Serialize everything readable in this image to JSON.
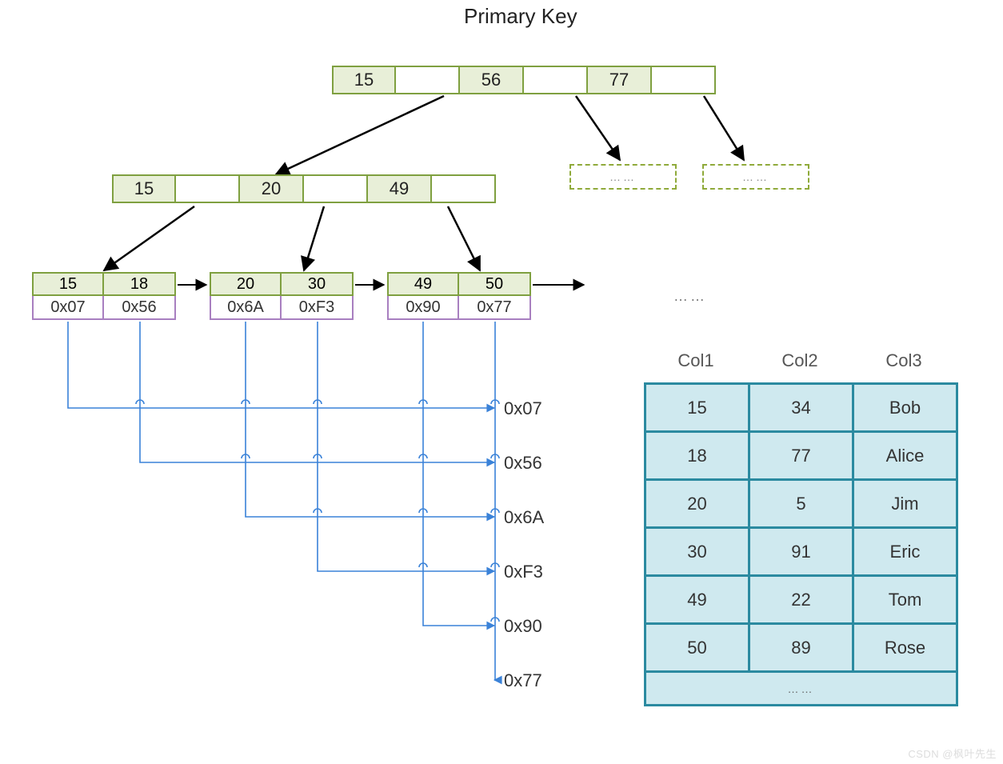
{
  "title": "Primary Key",
  "root": {
    "keys": [
      "15",
      "56",
      "77"
    ]
  },
  "level2": {
    "keys": [
      "15",
      "20",
      "49"
    ]
  },
  "placeholder": "……",
  "leaves": [
    {
      "keys": [
        "15",
        "18"
      ],
      "ptrs": [
        "0x07",
        "0x56"
      ]
    },
    {
      "keys": [
        "20",
        "30"
      ],
      "ptrs": [
        "0x6A",
        "0xF3"
      ]
    },
    {
      "keys": [
        "49",
        "50"
      ],
      "ptrs": [
        "0x90",
        "0x77"
      ]
    }
  ],
  "leaf_trail": "……",
  "addresses": [
    "0x07",
    "0x56",
    "0x6A",
    "0xF3",
    "0x90",
    "0x77"
  ],
  "table": {
    "headers": [
      "Col1",
      "Col2",
      "Col3"
    ],
    "rows": [
      [
        "15",
        "34",
        "Bob"
      ],
      [
        "18",
        "77",
        "Alice"
      ],
      [
        "20",
        "5",
        "Jim"
      ],
      [
        "30",
        "91",
        "Eric"
      ],
      [
        "49",
        "22",
        "Tom"
      ],
      [
        "50",
        "89",
        "Rose"
      ]
    ],
    "trail": "……"
  },
  "watermark": "CSDN @枫叶先生"
}
